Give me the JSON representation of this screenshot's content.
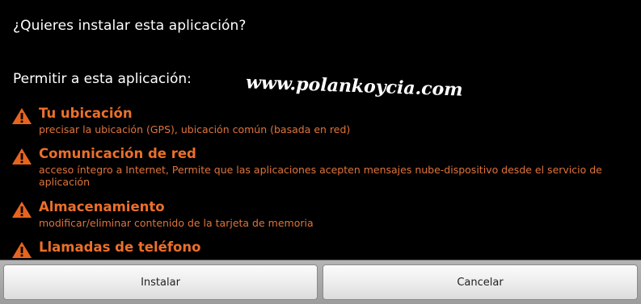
{
  "dialog": {
    "title": "¿Quieres instalar esta aplicación?",
    "subheading": "Permitir a esta aplicación:",
    "watermark": "www.polankoycia.com"
  },
  "permissions": [
    {
      "title": "Tu ubicación",
      "description": "precisar la ubicación (GPS), ubicación común (basada en red)",
      "icon": "warning-icon"
    },
    {
      "title": "Comunicación de red",
      "description": "acceso íntegro a Internet, Permite que las aplicaciones acepten mensajes nube-dispositivo desde el servicio de aplicación",
      "icon": "warning-icon"
    },
    {
      "title": "Almacenamiento",
      "description": "modificar/eliminar contenido de la tarjeta de memoria",
      "icon": "warning-icon"
    },
    {
      "title": "Llamadas de teléfono",
      "description": "",
      "icon": "warning-icon"
    }
  ],
  "buttons": {
    "install": "Instalar",
    "cancel": "Cancelar"
  },
  "colors": {
    "permission_title": "#ec6f2a",
    "permission_desc": "#e0733a",
    "warning_icon": "#e8641e",
    "background": "#000000"
  }
}
